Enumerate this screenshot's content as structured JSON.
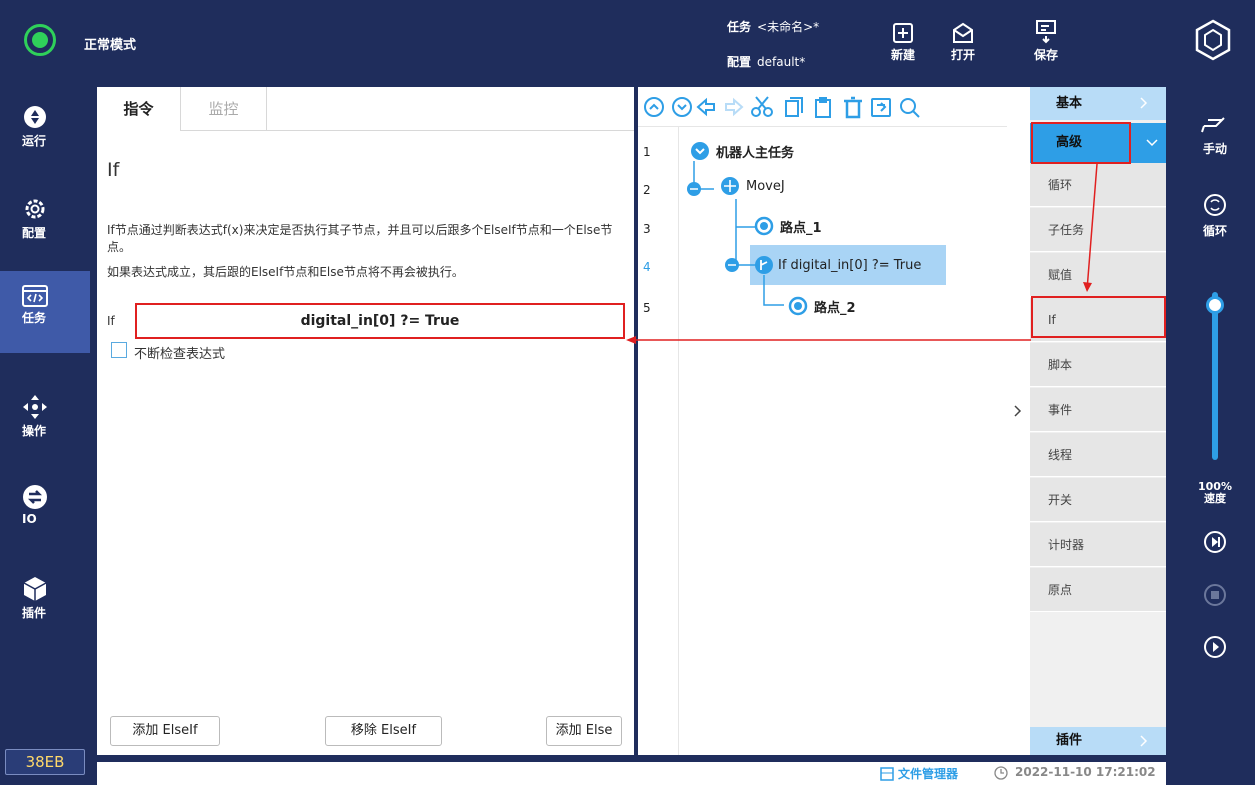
{
  "header": {
    "mode": "正常模式",
    "task_label": "任务",
    "task_value": "<未命名>*",
    "config_label": "配置",
    "config_value": "default*",
    "new_label": "新建",
    "open_label": "打开",
    "save_label": "保存"
  },
  "nav": {
    "items": [
      {
        "label": "运行"
      },
      {
        "label": "配置"
      },
      {
        "label": "任务"
      },
      {
        "label": "操作"
      },
      {
        "label": "IO"
      },
      {
        "label": "插件"
      }
    ],
    "version": "38EB"
  },
  "editor": {
    "tabs": [
      "指令",
      "监控"
    ],
    "title": "If",
    "description_line1": "If节点通过判断表达式f(x)来决定是否执行其子节点，并且可以后跟多个ElseIf节点和一个Else节点。",
    "description_line2": "如果表达式成立，其后跟的ElseIf节点和Else节点将不再会被执行。",
    "if_label": "If",
    "expression": "digital_in[0] ?= True",
    "checkbox_label": "不断检查表达式",
    "buttons": {
      "add_elseif": "添加 ElseIf",
      "remove_elseif": "移除 ElseIf",
      "add_else": "添加 Else"
    }
  },
  "tree": {
    "line_numbers": [
      "1",
      "2",
      "3",
      "4",
      "5"
    ],
    "nodes": [
      {
        "label": "机器人主任务"
      },
      {
        "label": "MoveJ"
      },
      {
        "label": "路点_1"
      },
      {
        "label": "If digital_in[0] ?= True"
      },
      {
        "label": "路点_2"
      }
    ]
  },
  "palette": {
    "basic": "基本",
    "advanced": "高级",
    "items": [
      "循环",
      "子任务",
      "赋值",
      "If",
      "脚本",
      "事件",
      "线程",
      "开关",
      "计时器",
      "原点"
    ],
    "plugins": "插件"
  },
  "rail": {
    "manual": "手动",
    "loop": "循环",
    "speed_value": "100%",
    "speed_label": "速度",
    "speed_level": 0.95
  },
  "footer": {
    "file_manager": "文件管理器",
    "datetime": "2022-11-10 17:21:02"
  },
  "colors": {
    "accent_red": "#e02020",
    "nav_bg": "#1f2d5c",
    "nav_active": "#3f5aa8",
    "selection": "#a9d4f5",
    "palette_header": "#b8dcf7",
    "tree_blue": "#2e9ee6"
  }
}
